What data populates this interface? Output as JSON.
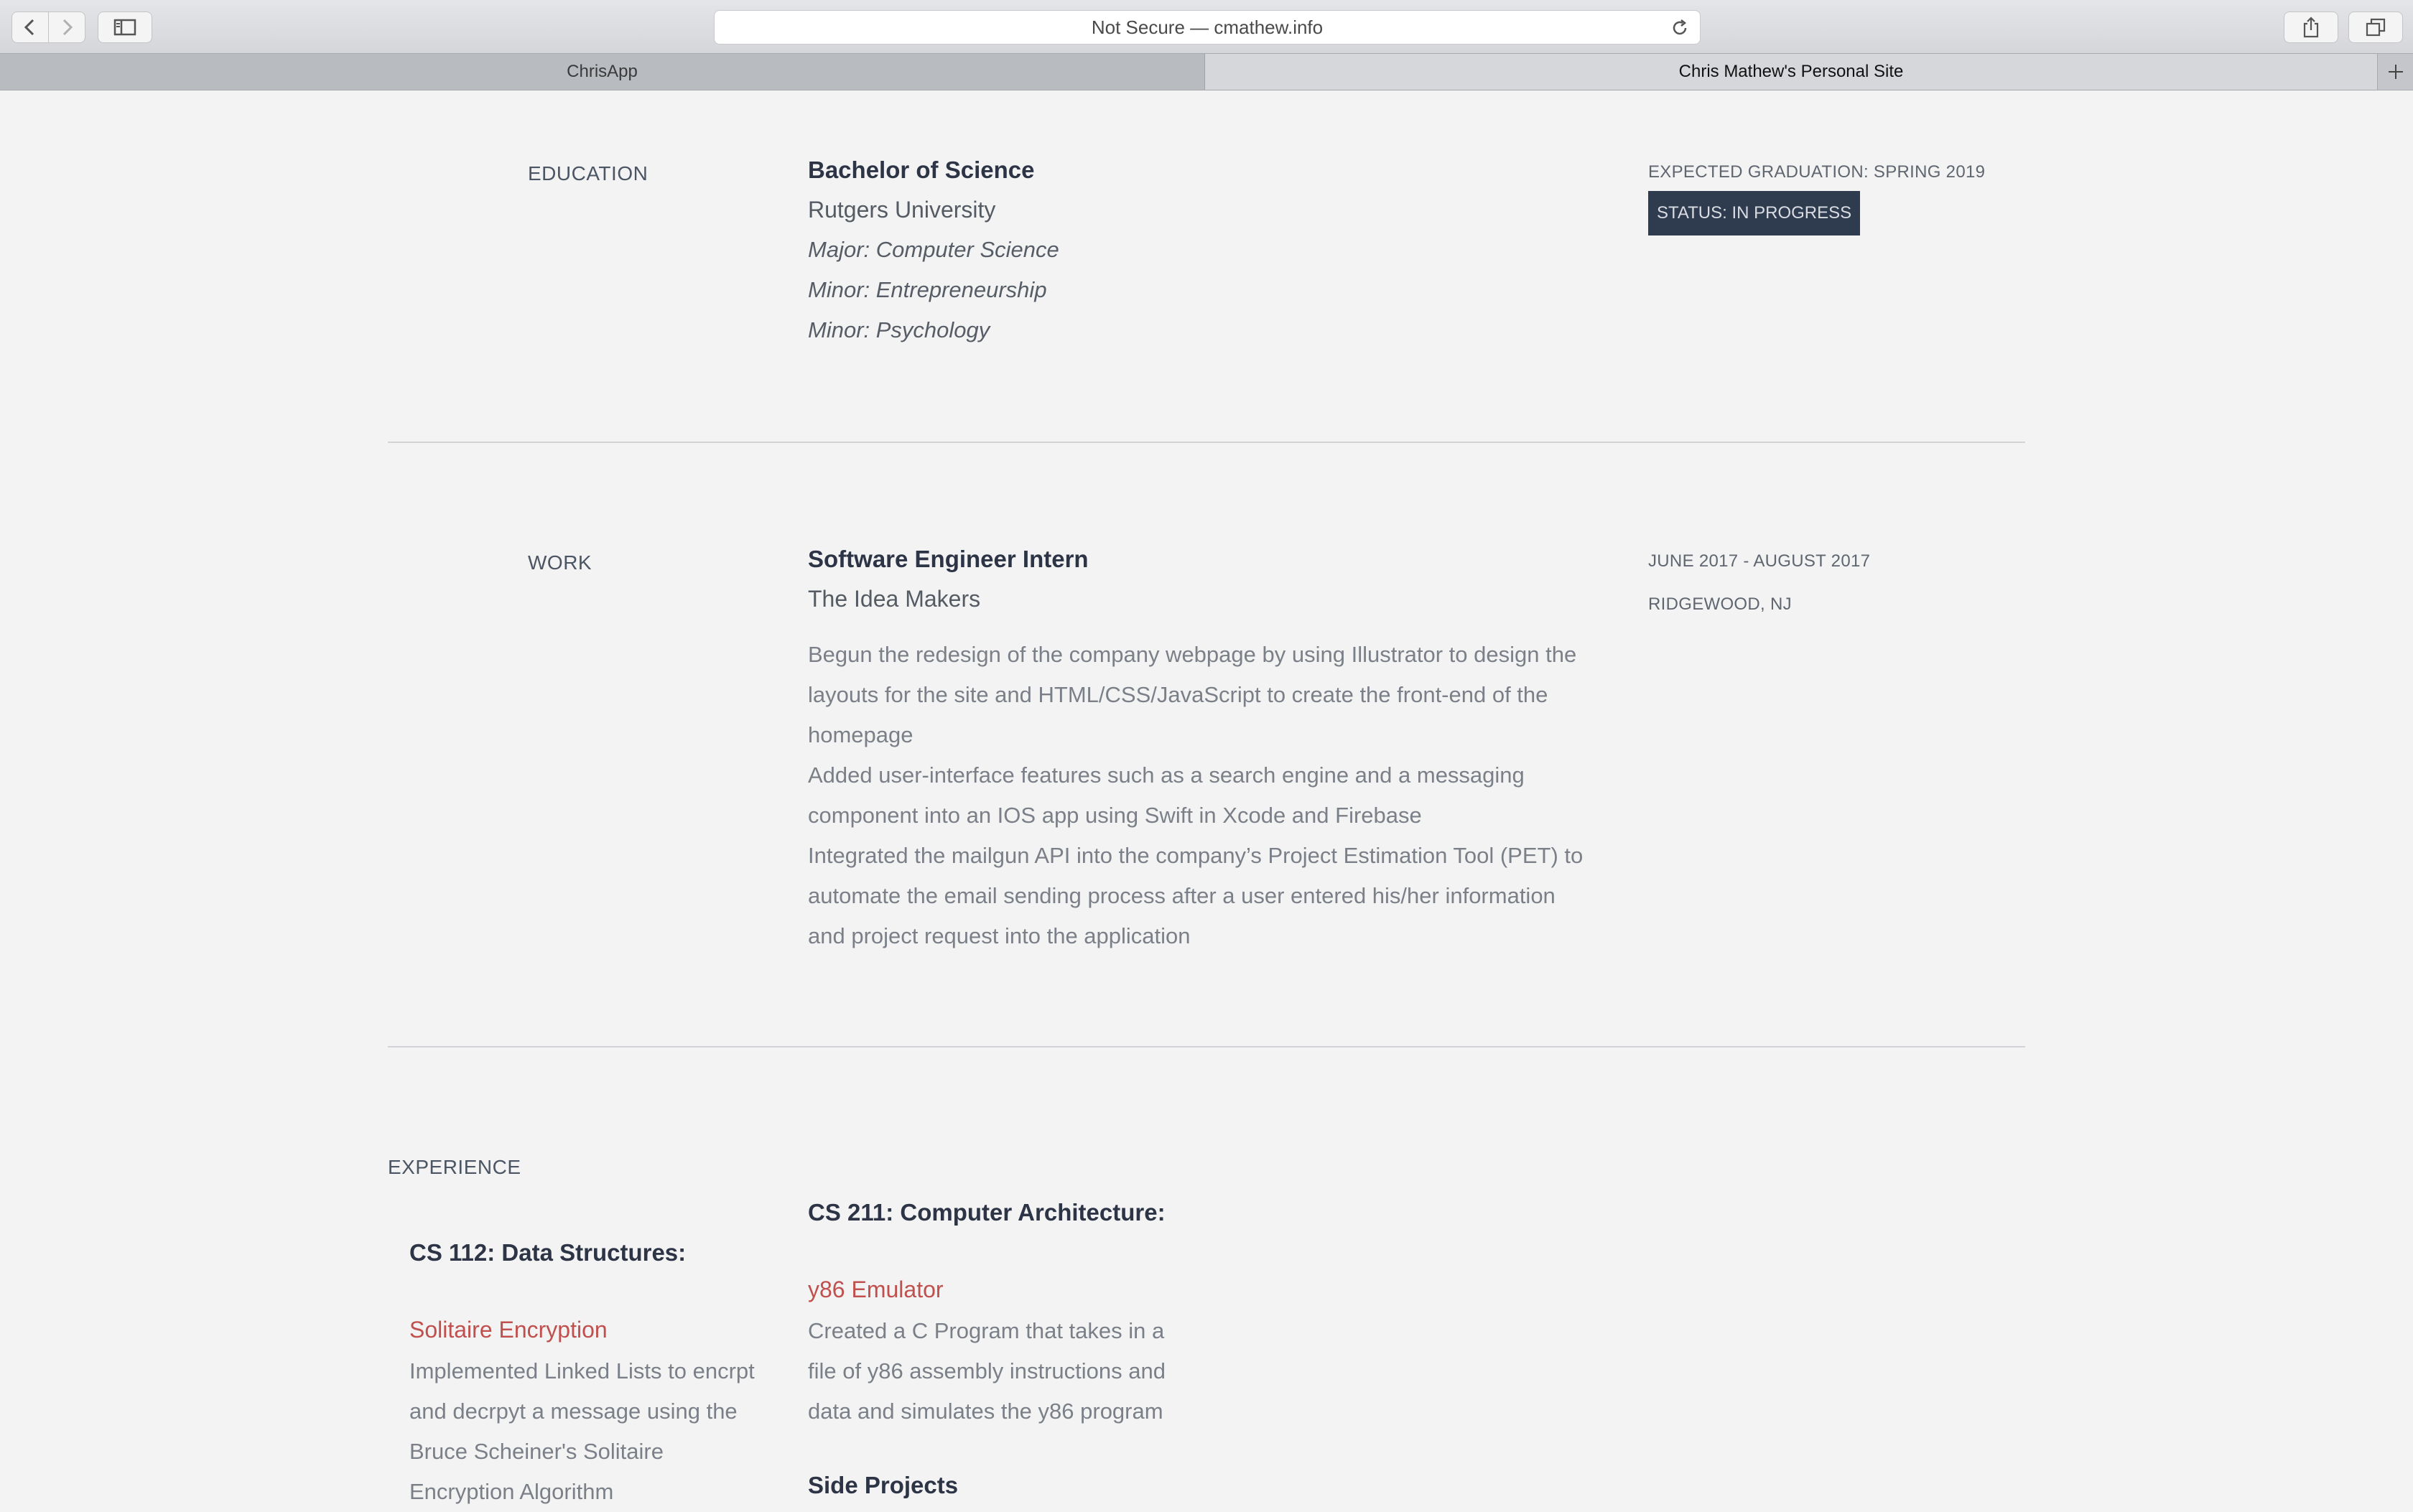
{
  "browser": {
    "address": "Not Secure — cmathew.info",
    "tabs": [
      {
        "label": "ChrisApp"
      },
      {
        "label": "Chris Mathew's Personal Site"
      }
    ]
  },
  "education": {
    "label": "EDUCATION",
    "degree": "Bachelor of Science",
    "school": "Rutgers University",
    "major": "Major: Computer Science",
    "minor1": "Minor: Entrepreneurship",
    "minor2": "Minor: Psychology",
    "graduation": "EXPECTED GRADUATION: SPRING 2019",
    "status": "STATUS: IN PROGRESS"
  },
  "work": {
    "label": "WORK",
    "title": "Software Engineer Intern",
    "company": "The Idea Makers",
    "dates": "JUNE 2017 - AUGUST 2017",
    "location": "RIDGEWOOD, NJ",
    "bullets": [
      "Begun the redesign of the company webpage by using Illustrator to design the layouts for the site and HTML/CSS/JavaScript to create the front-end of the homepage",
      "Added user-interface features such as a search engine and a messaging component into an IOS app using Swift in Xcode and Firebase",
      "Integrated the mailgun API into the company’s Project Estimation Tool (PET) to automate the email sending process after a user entered his/her information and project request into the application"
    ]
  },
  "experience": {
    "label": "EXPERIENCE",
    "cs112": {
      "heading": "CS 112: Data Structures:",
      "project": "Solitaire Encryption",
      "desc": "Implemented Linked Lists to encrpt and decrpyt a message using the Bruce Scheiner's Solitaire Encryption Algorithm"
    },
    "cs211": {
      "heading": "CS 211: Computer Architecture:",
      "project": "y86 Emulator",
      "desc": "Created a C Program that takes in a file of y86 assembly instructions and data and simulates the y86 program"
    },
    "side": "Side Projects"
  }
}
